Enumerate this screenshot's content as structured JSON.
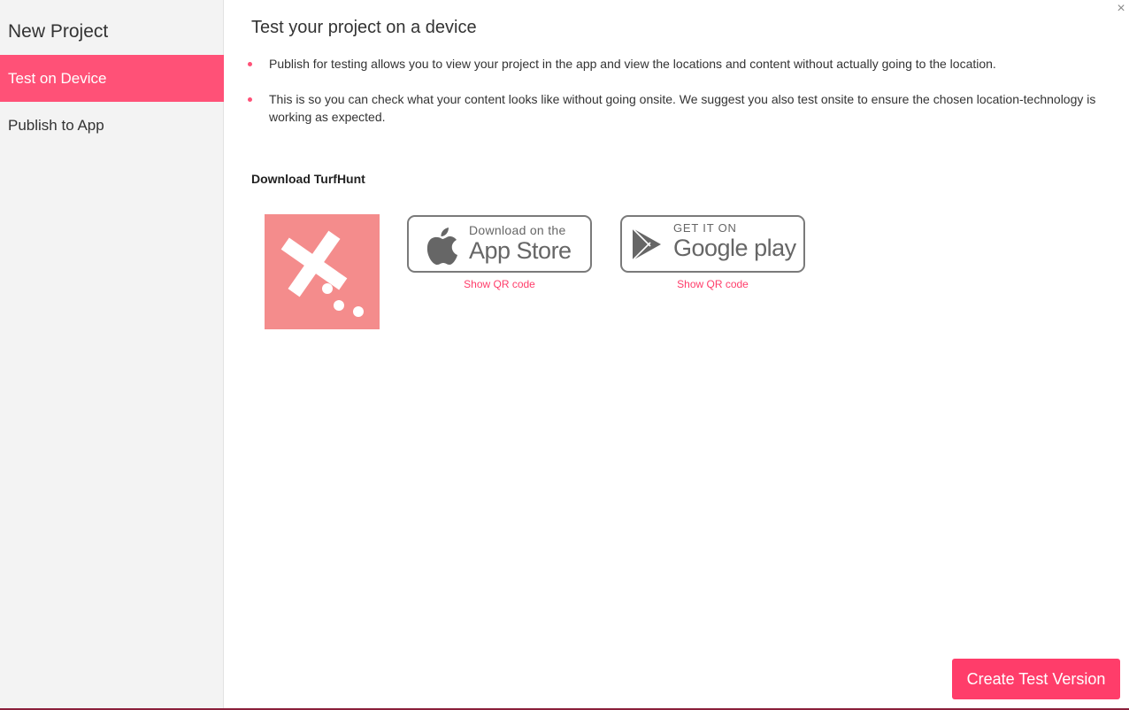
{
  "sidebar": {
    "title": "New Project",
    "items": [
      {
        "label": "Test on Device",
        "active": true
      },
      {
        "label": "Publish to App",
        "active": false
      }
    ]
  },
  "dialog": {
    "close_glyph": "×",
    "close_icon": "close-icon"
  },
  "main": {
    "title": "Test your project on a device",
    "bullets": [
      "Publish for testing allows you to view your project in the app and view the locations and content without actually going to the location.",
      "This is so you can check what your content looks like without going onsite. We suggest you also test onsite to ensure the chosen location-technology is working as expected."
    ],
    "download_label": "Download TurfHunt"
  },
  "badges": {
    "apple": {
      "small": "Download on the",
      "big": "App Store",
      "icon": "apple-icon"
    },
    "google": {
      "small": "GET IT ON",
      "big": "Google play",
      "icon": "google-play-icon"
    },
    "qr_label_apple": "Show QR code",
    "qr_label_google": "Show QR code"
  },
  "app_logo": {
    "icon": "turfhunt-logo-icon",
    "color": "#f48c8c"
  },
  "footer": {
    "primary_button": "Create Test Version"
  },
  "colors": {
    "accent": "#ff5177",
    "button": "#ff3d6a",
    "sidebar_bg": "#f3f3f3",
    "badge_border": "#7a7a7a"
  }
}
